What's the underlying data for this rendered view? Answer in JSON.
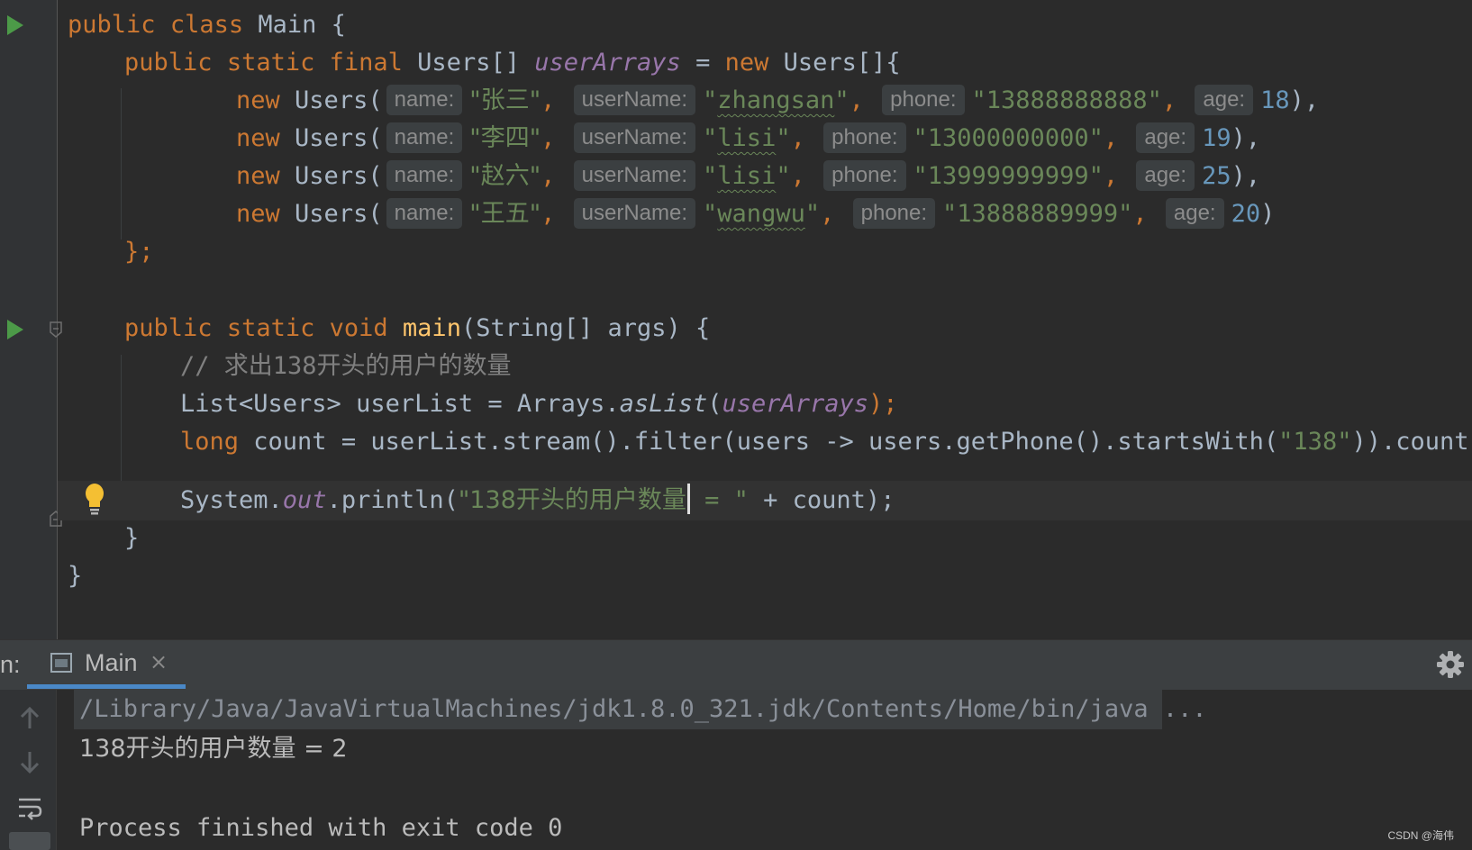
{
  "editor": {
    "line1": {
      "kw1": "public",
      "kw2": "class",
      "name": "Main",
      "brace": "{"
    },
    "line2": {
      "kw1": "public",
      "kw2": "static",
      "kw3": "final",
      "type": "Users[]",
      "field": "userArrays",
      "eq": "=",
      "kw4": "new",
      "rest": "Users[]{"
    },
    "users": [
      {
        "kw": "new",
        "ctor": "Users(",
        "hint_name": "name:",
        "name": "\"张三\"",
        "hint_user": "userName:",
        "user": "zhangsan",
        "hint_phone": "phone:",
        "phone": "\"13888888888\"",
        "hint_age": "age:",
        "age": "18",
        "end": "),"
      },
      {
        "kw": "new",
        "ctor": "Users(",
        "hint_name": "name:",
        "name": "\"李四\"",
        "hint_user": "userName:",
        "user": "lisi",
        "hint_phone": "phone:",
        "phone": "\"13000000000\"",
        "hint_age": "age:",
        "age": "19",
        "end": "),"
      },
      {
        "kw": "new",
        "ctor": "Users(",
        "hint_name": "name:",
        "name": "\"赵六\"",
        "hint_user": "userName:",
        "user": "lisi",
        "hint_phone": "phone:",
        "phone": "\"13999999999\"",
        "hint_age": "age:",
        "age": "25",
        "end": "),"
      },
      {
        "kw": "new",
        "ctor": "Users(",
        "hint_name": "name:",
        "name": "\"王五\"",
        "hint_user": "userName:",
        "user": "wangwu",
        "hint_phone": "phone:",
        "phone": "\"13888889999\"",
        "hint_age": "age:",
        "age": "20",
        "end": ")"
      }
    ],
    "array_close": "};",
    "main_sig": {
      "kw1": "public",
      "kw2": "static",
      "kw3": "void",
      "method": "main",
      "params": "(String[] args) {"
    },
    "comment": "// 求出138开头的用户的数量",
    "list_line": {
      "a": "List<Users> userList = Arrays.",
      "method": "asList",
      "b": "(",
      "field": "userArrays",
      "c": ");"
    },
    "count_line": {
      "kw": "long",
      "a": " count = userList.stream().filter(users -> users.getPhone().startsWith(",
      "str": "\"138\"",
      "b": ")).count();"
    },
    "print_line": {
      "a": "System.",
      "out": "out",
      "b": ".println(",
      "str1": "\"138开头的用户数量",
      "str2": " = \"",
      "c": " + count);"
    },
    "method_close": "}",
    "class_close": "}"
  },
  "run_panel": {
    "label": "n:",
    "tab_title": "Main",
    "tab_close": "×"
  },
  "console": {
    "command": "/Library/Java/JavaVirtualMachines/jdk1.8.0_321.jdk/Contents/Home/bin/java ...",
    "output": "138开头的用户数量 = 2",
    "exit": "Process finished with exit code 0"
  },
  "watermark": "CSDN @海伟",
  "colors": {
    "background": "#2b2b2b",
    "keyword": "#cc7832",
    "string": "#6a8759",
    "number": "#6897bb",
    "field": "#9876aa",
    "method_decl": "#ffc66d",
    "run_green": "#4c9a48",
    "tab_accent": "#4a88c7"
  },
  "icons": [
    "run-icon",
    "fold-icon",
    "intention-bulb-icon",
    "console-tab-icon",
    "close-icon",
    "gear-icon",
    "arrow-up-icon",
    "arrow-down-icon",
    "soft-wrap-icon"
  ]
}
